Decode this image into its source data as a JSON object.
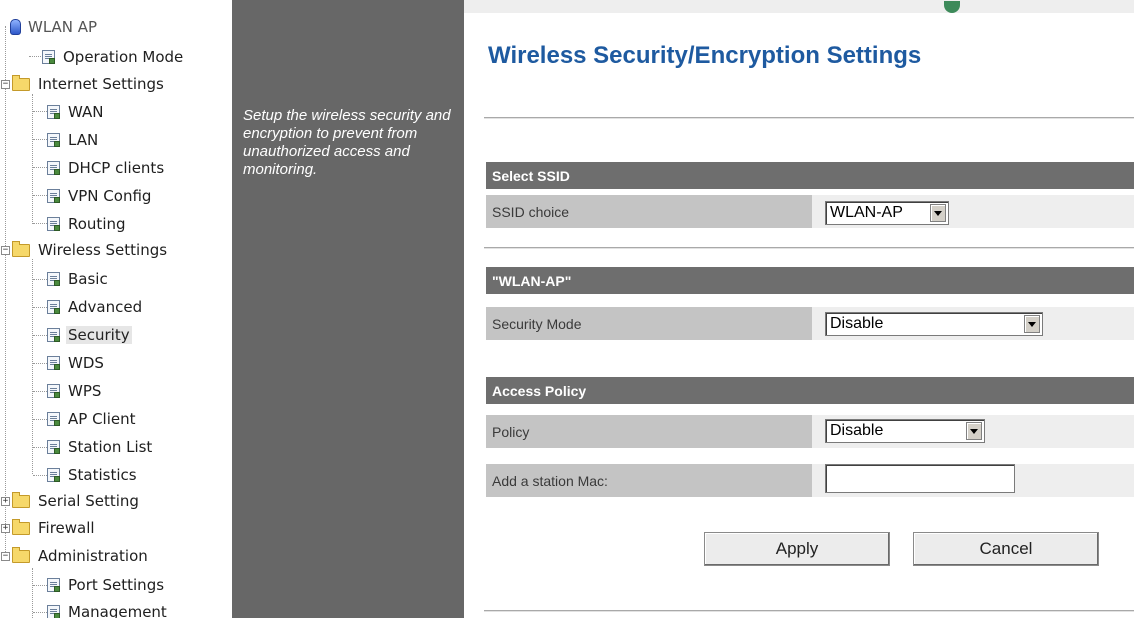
{
  "tree": {
    "root": "WLAN AP",
    "items": {
      "operation_mode": "Operation Mode",
      "internet_settings": "Internet Settings",
      "wan": "WAN",
      "lan": "LAN",
      "dhcp_clients": "DHCP clients",
      "vpn_config": "VPN Config",
      "routing": "Routing",
      "wireless_settings": "Wireless Settings",
      "basic": "Basic",
      "advanced": "Advanced",
      "security": "Security",
      "wds": "WDS",
      "wps": "WPS",
      "ap_client": "AP Client",
      "station_list": "Station List",
      "statistics": "Statistics",
      "serial_setting": "Serial Setting",
      "firewall": "Firewall",
      "administration": "Administration",
      "port_settings": "Port Settings",
      "management": "Management"
    },
    "selected": "Security"
  },
  "description": "Setup the wireless security and encryption to prevent from unauthorized access and monitoring.",
  "page_title": "Wireless Security/Encryption Settings",
  "select_ssid": {
    "header": "Select SSID",
    "ssid_label": "SSID choice",
    "ssid_value": "WLAN-AP"
  },
  "ssid_section": {
    "header": "\"WLAN-AP\"",
    "security_mode_label": "Security Mode",
    "security_mode_value": "Disable"
  },
  "access_policy": {
    "header": "Access Policy",
    "policy_label": "Policy",
    "policy_value": "Disable",
    "add_mac_label": "Add a station Mac:",
    "add_mac_value": ""
  },
  "buttons": {
    "apply": "Apply",
    "cancel": "Cancel"
  }
}
